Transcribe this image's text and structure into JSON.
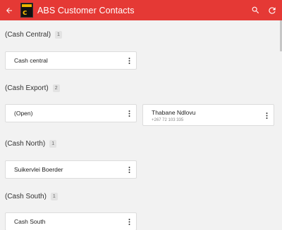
{
  "app": {
    "title": "ABS Customer Contacts",
    "accent_color": "#e53935",
    "icons": {
      "back": "arrow-back-icon",
      "search": "search-icon",
      "refresh": "refresh-icon",
      "more": "more-vertical-icon"
    }
  },
  "sections": [
    {
      "title": "(Cash Central)",
      "count": "1",
      "contacts": [
        {
          "name": "Cash central",
          "phone": ""
        }
      ]
    },
    {
      "title": "(Cash Export)",
      "count": "2",
      "contacts": [
        {
          "name": "(Open)",
          "phone": ""
        },
        {
          "name": "Thabane Ndlovu",
          "phone": "+267 72 103 335"
        }
      ]
    },
    {
      "title": "(Cash North)",
      "count": "1",
      "contacts": [
        {
          "name": "Suikervlei Boerder",
          "phone": ""
        }
      ]
    },
    {
      "title": "(Cash South)",
      "count": "1",
      "contacts": [
        {
          "name": "Cash South",
          "phone": ""
        }
      ]
    }
  ]
}
